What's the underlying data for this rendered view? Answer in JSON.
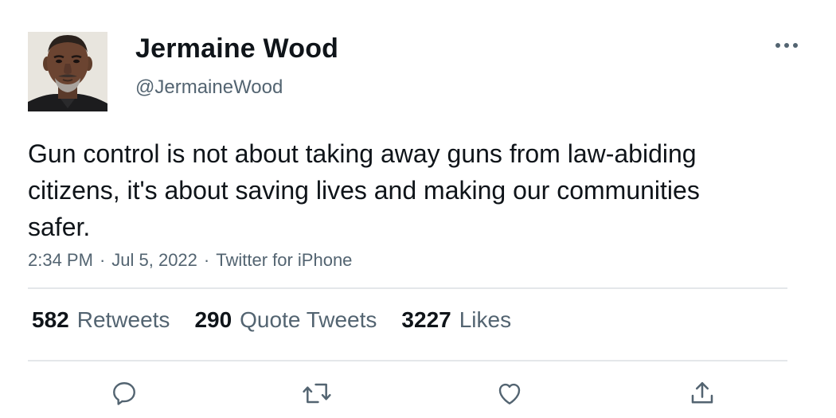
{
  "author": {
    "name": "Jermaine Wood",
    "handle": "@JermaineWood"
  },
  "tweet": {
    "text": "Gun control is not about taking away guns from law-abiding citizens, it's about saving lives and making our communities safer.",
    "time": "2:34 PM",
    "date": "Jul 5, 2022",
    "source": "Twitter for iPhone",
    "separator": "·"
  },
  "stats": {
    "retweets": {
      "count": "582",
      "label": "Retweets"
    },
    "quote_tweets": {
      "count": "290",
      "label": "Quote Tweets"
    },
    "likes": {
      "count": "3227",
      "label": "Likes"
    }
  },
  "icons": {
    "more": "more-horizontal-icon",
    "reply": "reply-icon",
    "retweet": "retweet-icon",
    "like": "heart-icon",
    "share": "share-icon"
  },
  "colors": {
    "primary_text": "#0f1419",
    "secondary_text": "#536471",
    "divider": "#e4e7ea"
  }
}
